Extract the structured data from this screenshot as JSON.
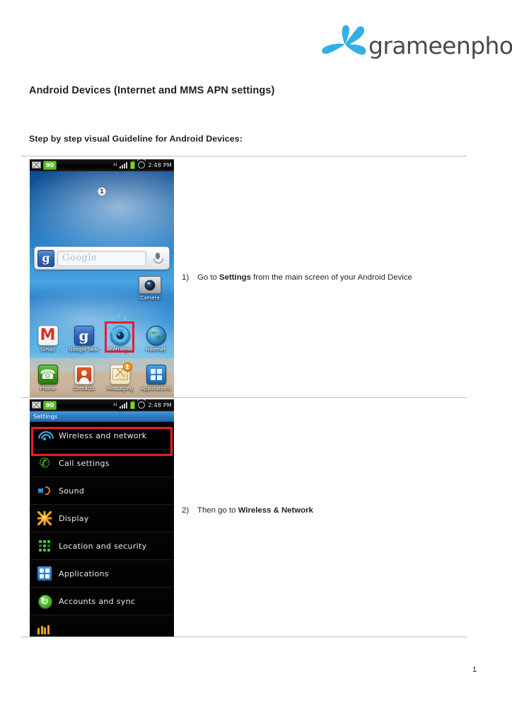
{
  "brand": {
    "logo_name": "grameenphone-logo",
    "wordmark": "grameenphone",
    "logo_color": "#29ABE2",
    "wordmark_color": "#4a4a4a"
  },
  "document": {
    "title": "Android Devices (Internet and MMS APN settings)",
    "subtitle": "Step by step visual Guideline for Android Devices:",
    "page_number": "1",
    "highlight_color": "#EE1C25"
  },
  "steps": [
    {
      "number": "1)",
      "text_before": "Go to ",
      "bold": "Settings",
      "text_after": " from the main screen of your Android Device"
    },
    {
      "number": "2)",
      "text_before": "Then go to ",
      "bold": "Wireless & Network",
      "text_after": ""
    }
  ],
  "screenshot_home": {
    "statusbar": {
      "mail_icon": "mail-icon",
      "badge": "90",
      "network_type": "H",
      "signal_icon": "signal-bars-icon",
      "battery_icon": "battery-icon",
      "alarm_icon": "alarm-clock-icon",
      "clock": "2:48 PM"
    },
    "page_indicator": "1",
    "search_widget": {
      "google_icon": "g",
      "placeholder": "Google",
      "mic_icon": "microphone-icon"
    },
    "camera_shortcut": {
      "label": "Camera"
    },
    "app_row_1": [
      {
        "label": "Gmail",
        "icon": "gmail-icon"
      },
      {
        "label": "Google Sear",
        "icon": "google-search-icon"
      },
      {
        "label": "Settings",
        "icon": "settings-gear-icon",
        "highlighted": true
      },
      {
        "label": "Internet",
        "icon": "internet-browser-icon"
      }
    ],
    "app_row_2": [
      {
        "label": "Phone",
        "icon": "phone-icon"
      },
      {
        "label": "Contacts",
        "icon": "contacts-icon"
      },
      {
        "label": "Messaging",
        "icon": "messaging-icon",
        "badge": "1"
      },
      {
        "label": "Applications",
        "icon": "applications-grid-icon"
      }
    ]
  },
  "screenshot_settings": {
    "statusbar": {
      "mail_icon": "mail-icon",
      "badge": "90",
      "network_type": "H",
      "signal_icon": "signal-bars-icon",
      "battery_icon": "battery-icon",
      "alarm_icon": "alarm-clock-icon",
      "clock": "2:48 PM"
    },
    "title": "Settings",
    "rows": [
      {
        "label": "Wireless and network",
        "icon": "wifi-icon",
        "highlighted": true
      },
      {
        "label": "Call settings",
        "icon": "call-icon"
      },
      {
        "label": "Sound",
        "icon": "sound-speaker-icon"
      },
      {
        "label": "Display",
        "icon": "display-brightness-icon"
      },
      {
        "label": "Location and security",
        "icon": "location-security-icon"
      },
      {
        "label": "Applications",
        "icon": "applications-grid-icon"
      },
      {
        "label": "Accounts and sync",
        "icon": "accounts-sync-icon"
      }
    ]
  }
}
